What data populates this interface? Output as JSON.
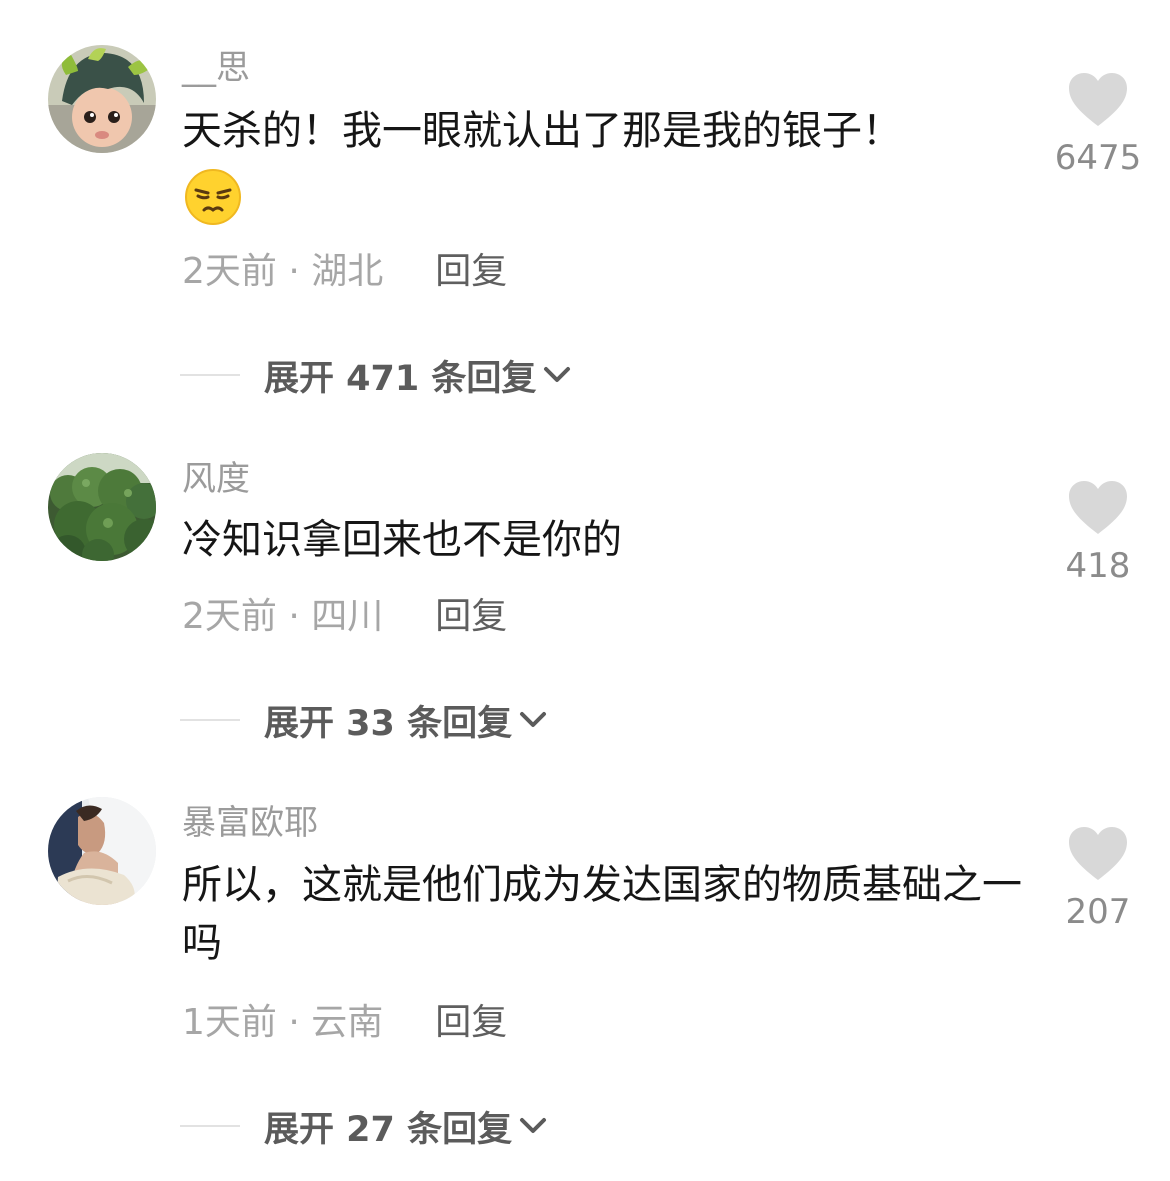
{
  "comments": [
    {
      "username": "__思",
      "text": "天杀的！我一眼就认出了那是我的银子！",
      "emoji": "smirk-face-emoji",
      "time_location": "2天前 · 湖北",
      "reply_label": "回复",
      "likes": "6475",
      "expand_label": "展开 471 条回复",
      "avatar_icon": "child-with-green-hair-avatar"
    },
    {
      "username": "风度",
      "text": "冷知识拿回来也不是你的",
      "time_location": "2天前 · 四川",
      "reply_label": "回复",
      "likes": "418",
      "expand_label": "展开 33 条回复",
      "avatar_icon": "broccoli-avatar"
    },
    {
      "username": "暴富欧耶",
      "text": "所以，这就是他们成为发达国家的物质基础之一吗",
      "time_location": "1天前 · 云南",
      "reply_label": "回复",
      "likes": "207",
      "expand_label": "展开 27 条回复",
      "avatar_icon": "bride-veil-photo-avatar"
    }
  ],
  "icons": {
    "like": "heart-icon",
    "expand": "chevron-down-icon"
  },
  "colors": {
    "text": "#161616",
    "secondary": "#9b9b9b",
    "heart": "#d8d8d8",
    "expand_text": "#5b5b5b"
  }
}
